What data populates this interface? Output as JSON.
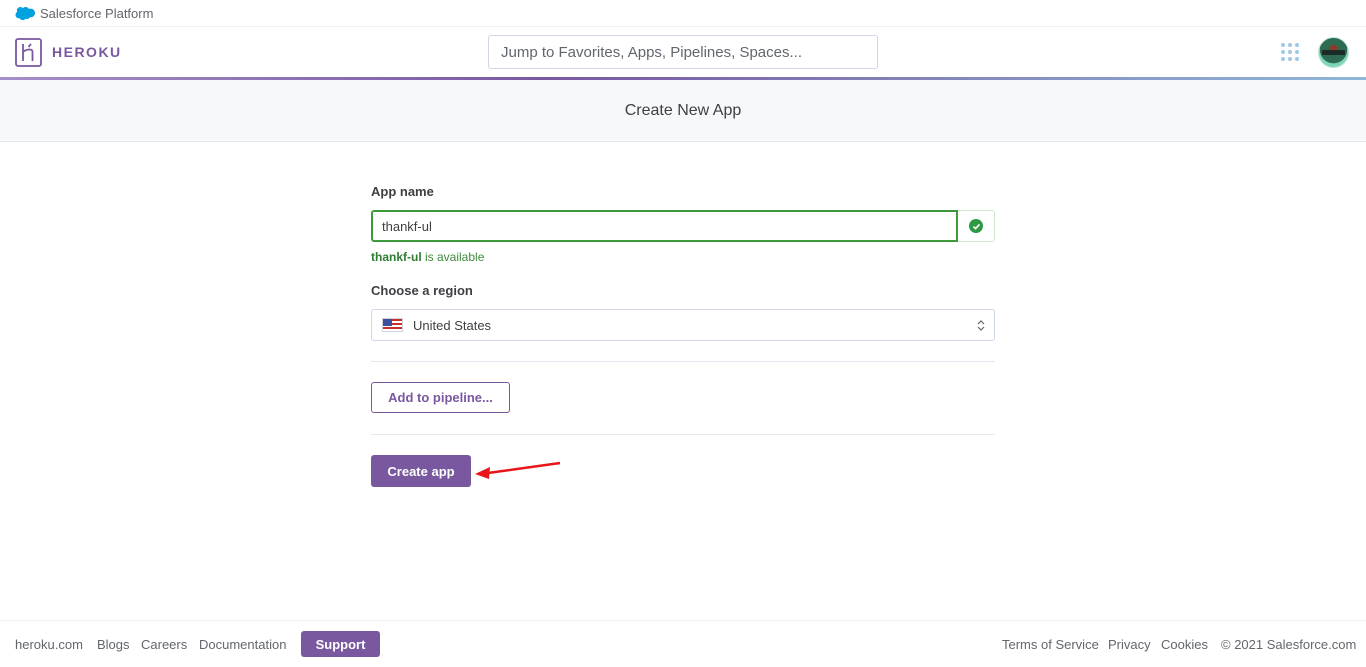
{
  "salesforce": {
    "label": "Salesforce Platform",
    "icon": "salesforce-cloud-icon",
    "color": "#00a1e0"
  },
  "header": {
    "brand": "HEROKU",
    "search_placeholder": "Jump to Favorites, Apps, Pipelines, Spaces...",
    "brand_color": "#79589f"
  },
  "page": {
    "title": "Create New App"
  },
  "form": {
    "app_name_label": "App name",
    "app_name_value": "thankf-ul",
    "availability_name": "thankf-ul",
    "availability_suffix": " is available",
    "region_label": "Choose a region",
    "region_value": "United States",
    "pipeline_button": "Add to pipeline...",
    "create_button": "Create app"
  },
  "footer": {
    "links": [
      "heroku.com",
      "Blogs",
      "Careers",
      "Documentation"
    ],
    "support": "Support",
    "right_links": [
      "Terms of Service",
      "Privacy",
      "Cookies"
    ],
    "copyright": "© 2021 Salesforce.com"
  }
}
